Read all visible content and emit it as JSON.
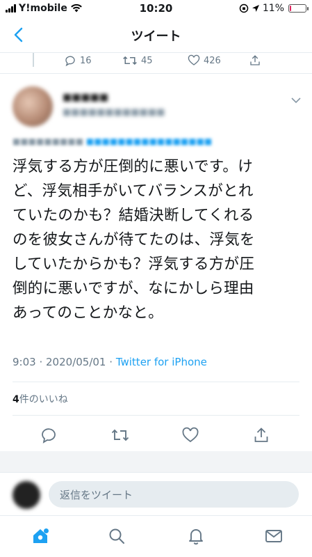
{
  "status_bar": {
    "carrier": "Y!mobile",
    "time": "10:20",
    "battery": "11%",
    "battery_level": 0.11
  },
  "nav": {
    "title": "ツイート"
  },
  "previous_tweet": {
    "replies": "16",
    "retweets": "45",
    "likes": "426"
  },
  "tweet": {
    "text_lines": [
      "浮気する方が圧倒的に悪いです。け",
      "ど、浮気相手がいてバランスがとれ",
      "ていたのかも？結婚決断してくれる",
      "のを彼女さんが待てたのは、浮気を",
      "していたからかも？浮気する方が圧",
      "倒的に悪いですが、なにかしら理由",
      "あってのことかなと。"
    ],
    "time": "9:03",
    "date": "2020/05/01",
    "source": "Twitter for iPhone",
    "like_count": "4",
    "like_label": "件のいいね"
  },
  "reply_bar": {
    "placeholder": "返信をツイート"
  },
  "colors": {
    "accent": "#1da1f2",
    "muted": "#657786",
    "divider": "#e6ecf0"
  }
}
